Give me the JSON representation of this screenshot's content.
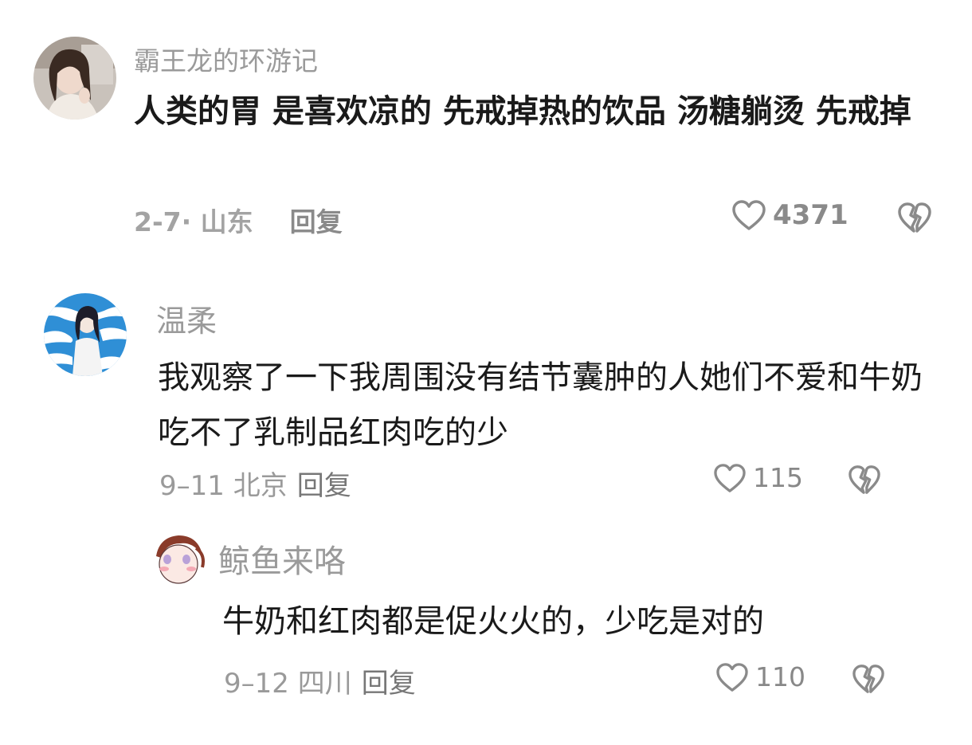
{
  "comments": [
    {
      "username": "霸王龙的环游记",
      "text": "人类的胃 是喜欢凉的 先戒掉热的饮品 汤糖躺烫 先戒掉",
      "date_location": "2-7· 山东",
      "reply_label": "回复",
      "likes": "4371"
    },
    {
      "username": "温柔",
      "text": "我观察了一下我周围没有结节囊肿的人她们不爱和牛奶吃不了乳制品红肉吃的少",
      "date_location": "9–11 北京",
      "reply_label": "回复",
      "likes": "115"
    },
    {
      "username": "鲸鱼来咯",
      "text": "牛奶和红肉都是促火火的，少吃是对的",
      "date_location": "9–12 四川",
      "reply_label": "回复",
      "likes": "110"
    }
  ],
  "icons": {
    "like": "heart-outline-icon",
    "dislike": "broken-heart-icon"
  },
  "colors": {
    "background": "#ffffff",
    "username": "#9a9a9a",
    "text": "#1a1a1a",
    "meta": "#9a9a9a",
    "icon": "#8a8a8a"
  }
}
